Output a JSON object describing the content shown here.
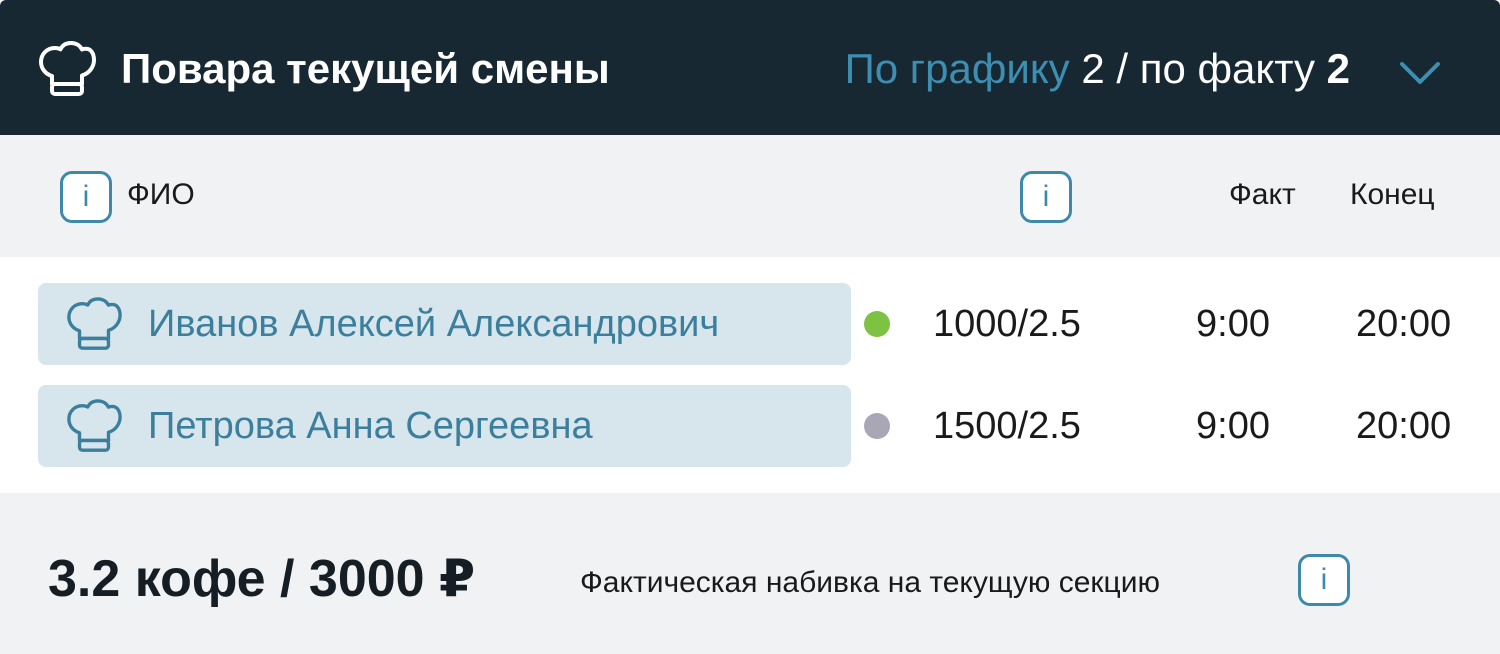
{
  "header": {
    "icon": "chef-hat-icon",
    "title": "Повара текущей смены",
    "schedule_label": "По графику",
    "schedule_count": "2",
    "separator": "/ по факту",
    "fact_count": "2",
    "chevron_icon": "chevron-down-icon"
  },
  "columns": {
    "info_symbol": "i",
    "name": "ФИО",
    "fact": "Факт",
    "end": "Конец"
  },
  "cooks": [
    {
      "name": "Иванов Алексей Александрович",
      "status_color": "#7dc242",
      "rate": "1000/2.5",
      "fact": "9:00",
      "end": "20:00"
    },
    {
      "name": "Петрова Анна Сергеевна",
      "status_color": "#a9a7b6",
      "rate": "1500/2.5",
      "fact": "9:00",
      "end": "20:00"
    }
  ],
  "footer": {
    "total": "3.2 кофе / 3000 ₽",
    "description": "Фактическая набивка на текущую секцию"
  },
  "colors": {
    "header_bg": "#172832",
    "accent": "#3d89ab",
    "chip_bg": "#d7e5ec",
    "band_bg": "#f0f2f4"
  }
}
